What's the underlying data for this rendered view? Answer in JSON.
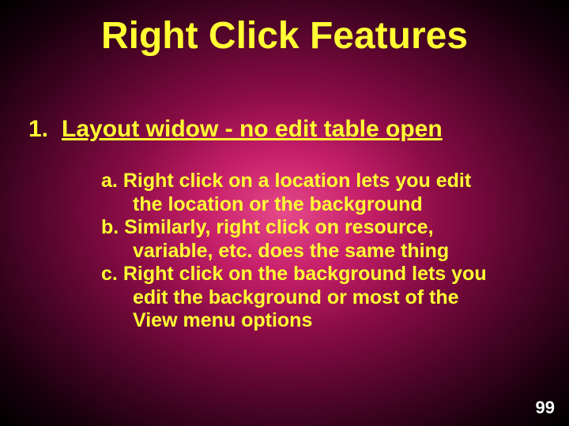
{
  "title": "Right Click Features",
  "section": {
    "number": "1.",
    "heading": "Layout widow - no edit table open"
  },
  "items": {
    "a": {
      "label": "a.",
      "line1": "Right click on a location lets you edit",
      "line2": "the location or the background"
    },
    "b": {
      "label": "b.",
      "line1": "Similarly, right click on resource,",
      "line2": "variable, etc. does the same thing"
    },
    "c": {
      "label": "c.",
      "line1": "Right click on the background lets  you",
      "line2": "edit the background or most of the",
      "line3": "View menu options"
    }
  },
  "page_number": "99"
}
